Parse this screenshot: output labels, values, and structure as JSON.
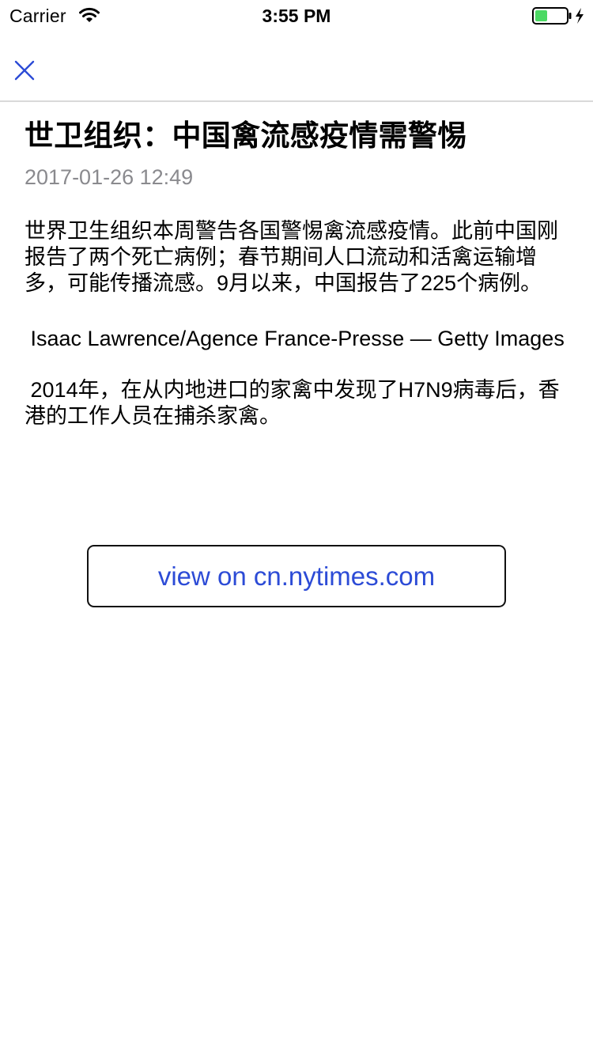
{
  "status_bar": {
    "carrier": "Carrier",
    "time": "3:55 PM",
    "battery_level": 0.4,
    "battery_color": "#4cd964"
  },
  "nav": {
    "close_icon": "close-icon",
    "accent_color": "#2c4bd6"
  },
  "article": {
    "title": "世卫组织：中国禽流感疫情需警惕",
    "date": "2017-01-26 12:49",
    "paragraphs": [
      "世界卫生组织本周警告各国警惕禽流感疫情。此前中国刚报告了两个死亡病例；春节期间人口流动和活禽运输增多，可能传播流感。9月以来，中国报告了225个病例。",
      " Isaac Lawrence/Agence France-Presse — Getty Images",
      " 2014年，在从内地进口的家禽中发现了H7N9病毒后，香港的工作人员在捕杀家禽。"
    ]
  },
  "actions": {
    "view_button_label": "view on cn.nytimes.com"
  }
}
